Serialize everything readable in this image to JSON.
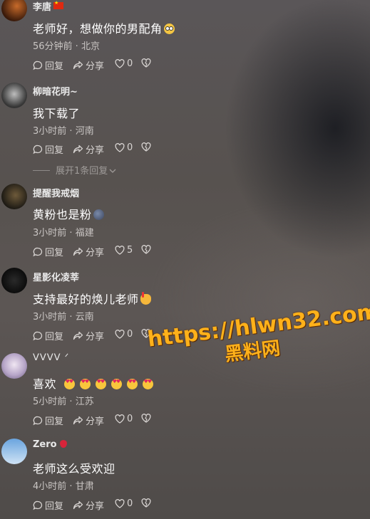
{
  "comments": [
    {
      "user": "李唐",
      "flag": "cn-flag-icon",
      "text": "老师好，想做你的男配角",
      "emoji": "flushed-face-icon",
      "time": "56分钟前",
      "location": "北京",
      "reply": "回复",
      "share": "分享",
      "likes": "0"
    },
    {
      "user": "柳暗花明~",
      "text": "我下载了",
      "time": "3小时前",
      "location": "河南",
      "reply": "回复",
      "share": "分享",
      "likes": "0",
      "more_replies": "展开1条回复"
    },
    {
      "user": "提醒我戒烟",
      "text": "黄粉也是粉",
      "emoji": "moon-face-icon",
      "time": "3小时前",
      "location": "福建",
      "reply": "回复",
      "share": "分享",
      "likes": "5"
    },
    {
      "user": "星影化凌莘",
      "text": "支持最好的焕儿老师",
      "emoji": "thumbs-up-icon",
      "time": "3小时前",
      "location": "云南",
      "reply": "回复",
      "share": "分享",
      "likes": "0"
    },
    {
      "user": "ᐯᐯᐯᐯ ᐟ",
      "text": "喜欢",
      "emoji_count": 6,
      "time": "5小时前",
      "location": "江苏",
      "reply": "回复",
      "share": "分享",
      "likes": "0"
    },
    {
      "user": "Zero",
      "text": "老师这么受欢迎",
      "time": "4小时前",
      "location": "甘肃",
      "reply": "回复",
      "share": "分享",
      "likes": "0"
    }
  ],
  "watermark": {
    "line1": "https://hlwn32.com",
    "line2": "黑料网"
  },
  "meta_separator": " · "
}
